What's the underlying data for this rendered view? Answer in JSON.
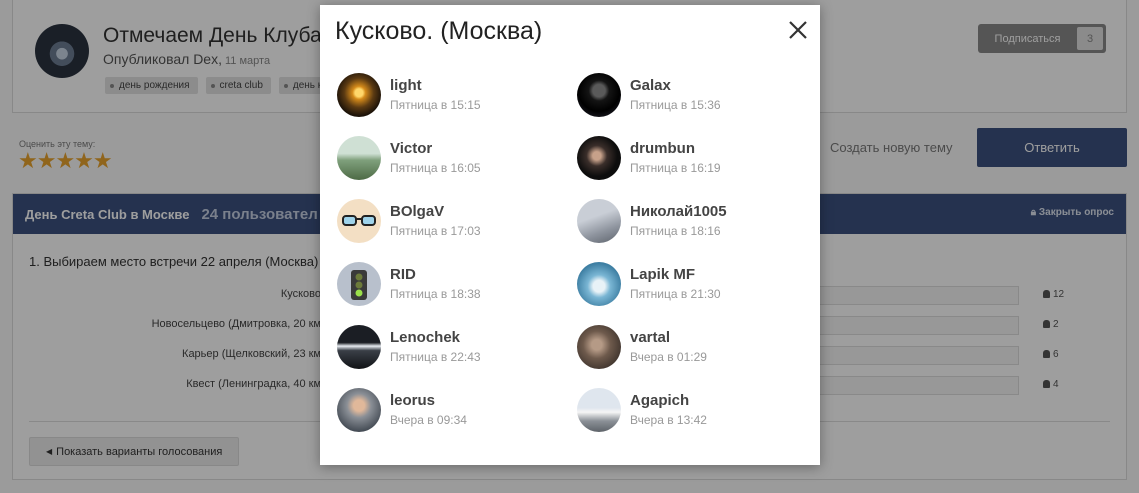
{
  "topic": {
    "title": "Отмечаем День Клуба",
    "published_by": "Опубликовал Dex,",
    "date": "11 марта",
    "tags": [
      "день рождения",
      "creta club",
      "день к"
    ],
    "subscribe_label": "Подписаться",
    "subscribe_count": "3"
  },
  "rating": {
    "label": "Оценить эту тему:",
    "stars": "★★★★★"
  },
  "actions": {
    "new_topic": "Создать новую тему",
    "reply": "Ответить"
  },
  "poll": {
    "title": "День Creta Club в Москве",
    "voters": "24 пользовател",
    "close": "Закрыть опрос",
    "question": "1. Выбираем место встречи 22 апреля (Москва)",
    "options": [
      {
        "label": "Кусково",
        "count": "12"
      },
      {
        "label": "Новосельцево (Дмитровка, 20 км",
        "count": "2"
      },
      {
        "label": "Карьер (Щелковский, 23 км",
        "count": "6"
      },
      {
        "label": "Квест (Ленинградка, 40 км",
        "count": "4"
      }
    ],
    "show_votes": "Показать варианты голосования"
  },
  "modal": {
    "title": "Кусково. (Москва)",
    "close_icon": "close-icon",
    "voters": [
      {
        "name": "light",
        "time": "Пятница в 15:15"
      },
      {
        "name": "Galax",
        "time": "Пятница в 15:36"
      },
      {
        "name": "Victor",
        "time": "Пятница в 16:05"
      },
      {
        "name": "drumbun",
        "time": "Пятница в 16:19"
      },
      {
        "name": "BOlgaV",
        "time": "Пятница в 17:03"
      },
      {
        "name": "Николай1005",
        "time": "Пятница в 18:16"
      },
      {
        "name": "RID",
        "time": "Пятница в 18:38"
      },
      {
        "name": "Lapik MF",
        "time": "Пятница в 21:30"
      },
      {
        "name": "Lenochek",
        "time": "Пятница в 22:43"
      },
      {
        "name": "vartal",
        "time": "Вчера в 01:29"
      },
      {
        "name": "leorus",
        "time": "Вчера в 09:34"
      },
      {
        "name": "Agapich",
        "time": "Вчера в 13:42"
      }
    ]
  },
  "colors": {
    "accent": "#3c5280",
    "star": "#e8a32e"
  }
}
